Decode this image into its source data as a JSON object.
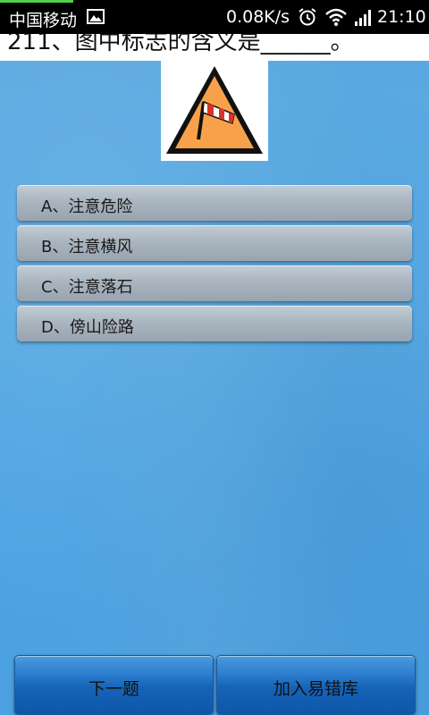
{
  "status_bar": {
    "carrier": "中国移动",
    "net_speed": "0.08K/s",
    "time": "21:10",
    "icons": [
      "image-notification-icon",
      "alarm-icon",
      "wifi-icon",
      "signal-icon"
    ]
  },
  "question": {
    "text": "211、图中标志的含义是______。",
    "sign": {
      "icon": "crosswind-warning-sign",
      "fill_color": "#f7a24a",
      "border_color": "#111111"
    }
  },
  "options": [
    {
      "label": "A、注意危险"
    },
    {
      "label": "B、注意横风"
    },
    {
      "label": "C、注意落石"
    },
    {
      "label": "D、傍山险路"
    }
  ],
  "buttons": {
    "next_label": "下一题",
    "add_label": "加入易错库"
  }
}
